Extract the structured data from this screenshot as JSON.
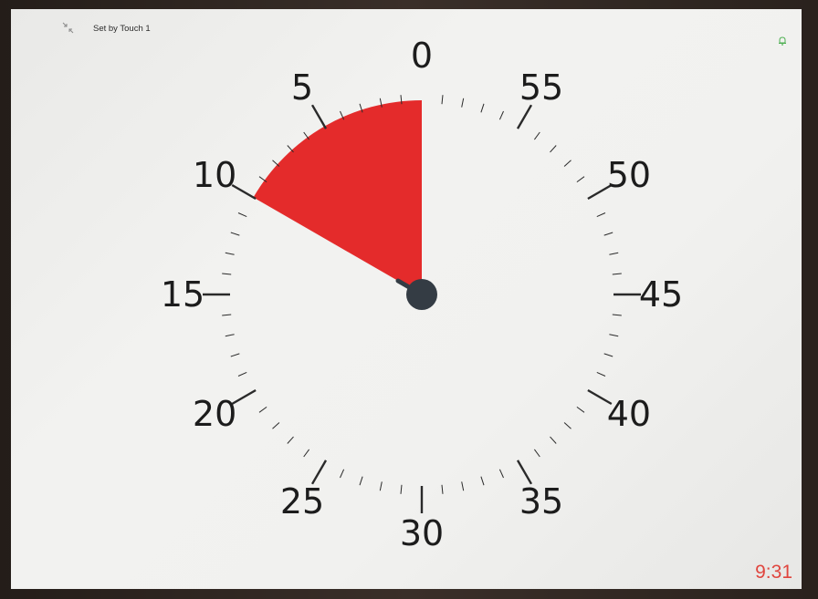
{
  "header": {
    "mode_label": "Set by Touch 1",
    "collapse_icon": "collapse-arrows-icon",
    "alarm_icon": "bell-icon"
  },
  "timer": {
    "dial_labels": [
      "0",
      "5",
      "10",
      "15",
      "20",
      "25",
      "30",
      "35",
      "40",
      "45",
      "50",
      "55"
    ],
    "remaining_minutes": 10,
    "dial_total_minutes": 60,
    "disc_color": "#e42b2b",
    "hand_color": "#343c44"
  },
  "status": {
    "time": "9:31",
    "time_color": "#e0453e"
  },
  "colors": {
    "alarm_icon": "#4caf50"
  }
}
